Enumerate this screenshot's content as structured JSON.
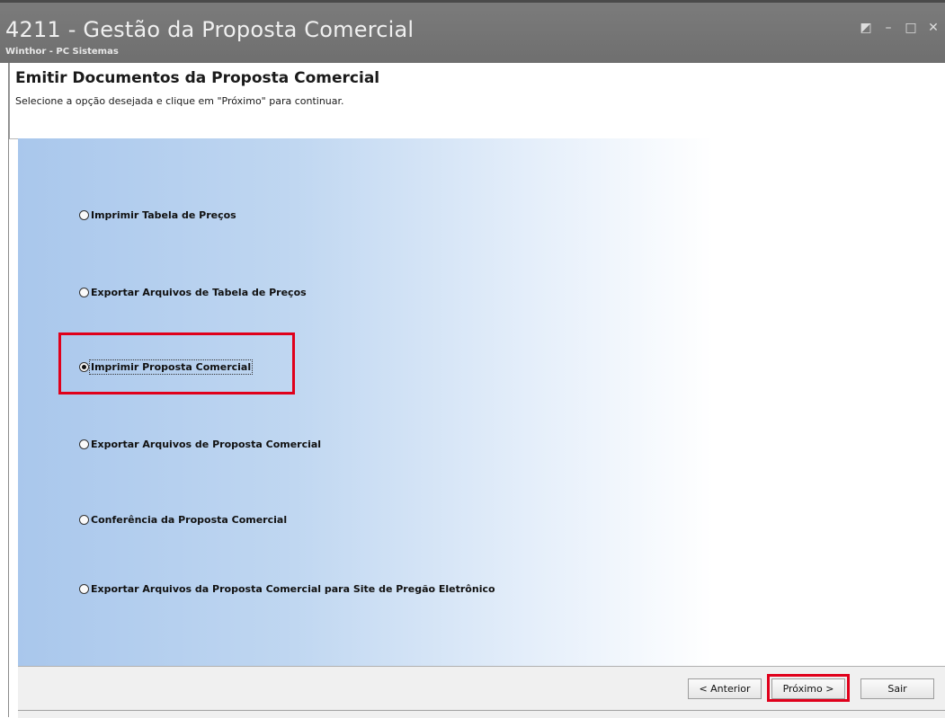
{
  "window": {
    "title": "4211 - Gestão da Proposta Comercial",
    "subtitle": "Winthor - PC Sistemas",
    "controls": [
      "◩",
      "–",
      "□",
      "✕"
    ]
  },
  "header": {
    "title": "Emitir Documentos da Proposta Comercial",
    "instruction": "Selecione a opção desejada e clique em \"Próximo\" para continuar."
  },
  "options": [
    {
      "label": "Imprimir Tabela de Preços",
      "selected": false
    },
    {
      "label": "Exportar Arquivos de Tabela de Preços",
      "selected": false
    },
    {
      "label": "Imprimir Proposta Comercial",
      "selected": true
    },
    {
      "label": "Exportar Arquivos de Proposta Comercial",
      "selected": false
    },
    {
      "label": "Conferência da Proposta Comercial",
      "selected": false
    },
    {
      "label": "Exportar Arquivos da Proposta Comercial para Site de Pregão Eletrônico",
      "selected": false
    }
  ],
  "buttons": {
    "back": "< Anterior",
    "next": "Próximo >",
    "exit": "Sair"
  },
  "colors": {
    "highlight": "#e0001b",
    "titlebar": "#747474",
    "gradient_start": "#a9c7ec"
  }
}
